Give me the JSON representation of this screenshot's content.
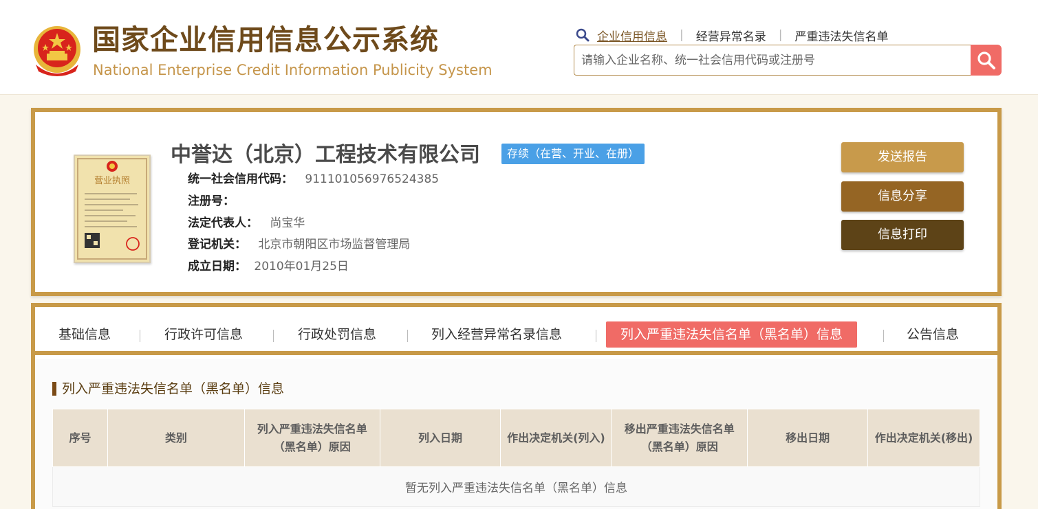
{
  "header": {
    "title_cn": "国家企业信用信息公示系统",
    "title_en": "National Enterprise Credit Information Publicity System",
    "nav": [
      "企业信用信息",
      "经营异常名录",
      "严重违法失信名单"
    ],
    "search_placeholder": "请输入企业名称、统一社会信用代码或注册号"
  },
  "company": {
    "name": "中誉达（北京）工程技术有限公司",
    "status": "存续（在营、开业、在册）",
    "fields": [
      {
        "label": "统一社会信用代码：",
        "value": "911101056976524385"
      },
      {
        "label": "注册号：",
        "value": ""
      },
      {
        "label": "法定代表人：",
        "value": "尚宝华"
      },
      {
        "label": "登记机关：",
        "value": "北京市朝阳区市场监督管理局"
      },
      {
        "label": "成立日期：",
        "value": "2010年01月25日"
      }
    ],
    "license_title": "营业执照",
    "buttons": {
      "send": "发送报告",
      "share": "信息分享",
      "print": "信息打印"
    }
  },
  "tabs": [
    {
      "label": "基础信息"
    },
    {
      "label": "行政许可信息"
    },
    {
      "label": "行政处罚信息"
    },
    {
      "label": "列入经营异常名录信息"
    },
    {
      "label": "列入严重违法失信名单（黑名单）信息",
      "active": true
    },
    {
      "label": "公告信息"
    }
  ],
  "section": {
    "title": "列入严重违法失信名单（黑名单）信息",
    "columns": [
      "序号",
      "类别",
      "列入严重违法失信名单（黑名单）原因",
      "列入日期",
      "作出决定机关(列入)",
      "移出严重违法失信名单（黑名单）原因",
      "移出日期",
      "作出决定机关(移出)"
    ],
    "empty_text": "暂无列入严重违法失信名单（黑名单）信息"
  },
  "colors": {
    "brand_gold": "#c89a48",
    "accent_red": "#f06b66",
    "status_blue": "#4aa0e6",
    "title_brown": "#6e4a1b"
  }
}
